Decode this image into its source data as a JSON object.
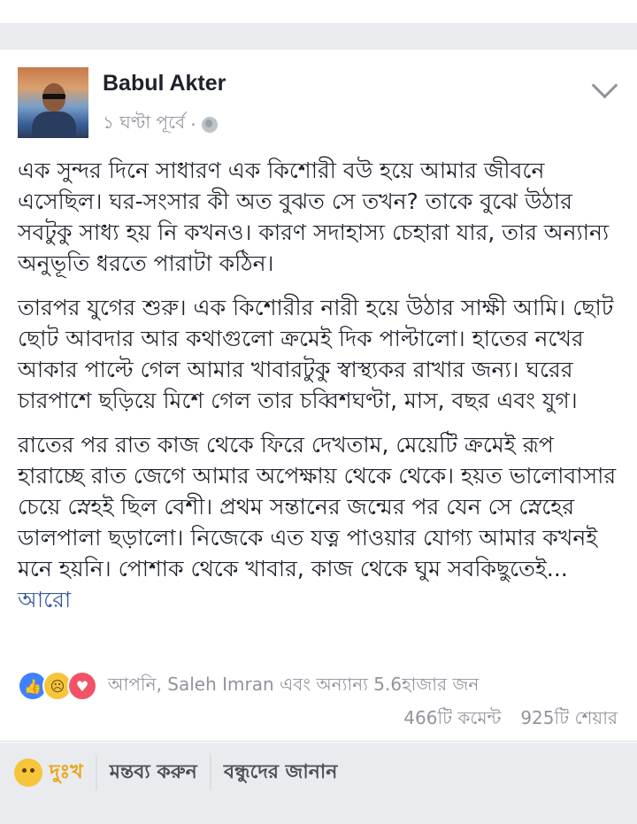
{
  "post": {
    "author": "Babul Akter",
    "timestamp": "১ ঘণ্টা পূর্বে",
    "meta_separator": "·",
    "privacy_icon": "globe-icon",
    "paragraphs": [
      "এক সুন্দর দিনে সাধারণ এক কিশোরী বউ হয়ে আমার জীবনে এসেছিল। ঘর-সংসার কী অত বুঝত সে তখন? তাকে বুঝে উঠার সবটুকু সাধ্য হয় নি কখনও। কারণ সদাহাস্য চেহারা যার, তার অন্যান্য অনুভূতি ধরতে পারাটা কঠিন।",
      "তারপর যুগের শুরু। এক কিশোরীর নারী হয়ে উঠার সাক্ষী আমি। ছোট ছোট আবদার আর কথাগুলো ক্রমেই দিক পাল্টালো। হাতের নখের আকার পাল্টে গেল আমার খাবারটুকু স্বাস্থ্যকর রাখার জন্য। ঘরের চারপাশে ছড়িয়ে মিশে গেল তার চব্বিশঘণ্টা, মাস, বছর এবং যুগ।",
      "রাতের পর রাত কাজ থেকে ফিরে দেখতাম, মেয়েটি ক্রমেই রূপ হারাচ্ছে রাত জেগে আমার অপেক্ষায় থেকে থেকে। হয়ত ভালোবাসার চেয়ে স্নেহই ছিল বেশী। প্রথম সন্তানের জন্মের পর যেন সে স্নেহের ডালপালা ছড়ালো। নিজেকে এত যত্ন পাওয়ার যোগ্য আমার কখনই মনে হয়নি। পোশাক থেকে খাবার, কাজ থেকে ঘুম সবকিছুতেই..."
    ],
    "see_more": "আরো",
    "reactions_summary": "আপনি, Saleh Imran এবং অন্যান্য 5.6হাজার জন",
    "comments_count": "466টি কমেন্ট",
    "shares_count": "925টি শেয়ার"
  },
  "actions": {
    "reaction_label": "দুঃখ",
    "comment_label": "মন্তব্য করুন",
    "share_label": "বন্ধুদের জানান"
  },
  "colors": {
    "link": "#365899",
    "muted": "#90949c",
    "sad_reaction": "#e9a410"
  }
}
